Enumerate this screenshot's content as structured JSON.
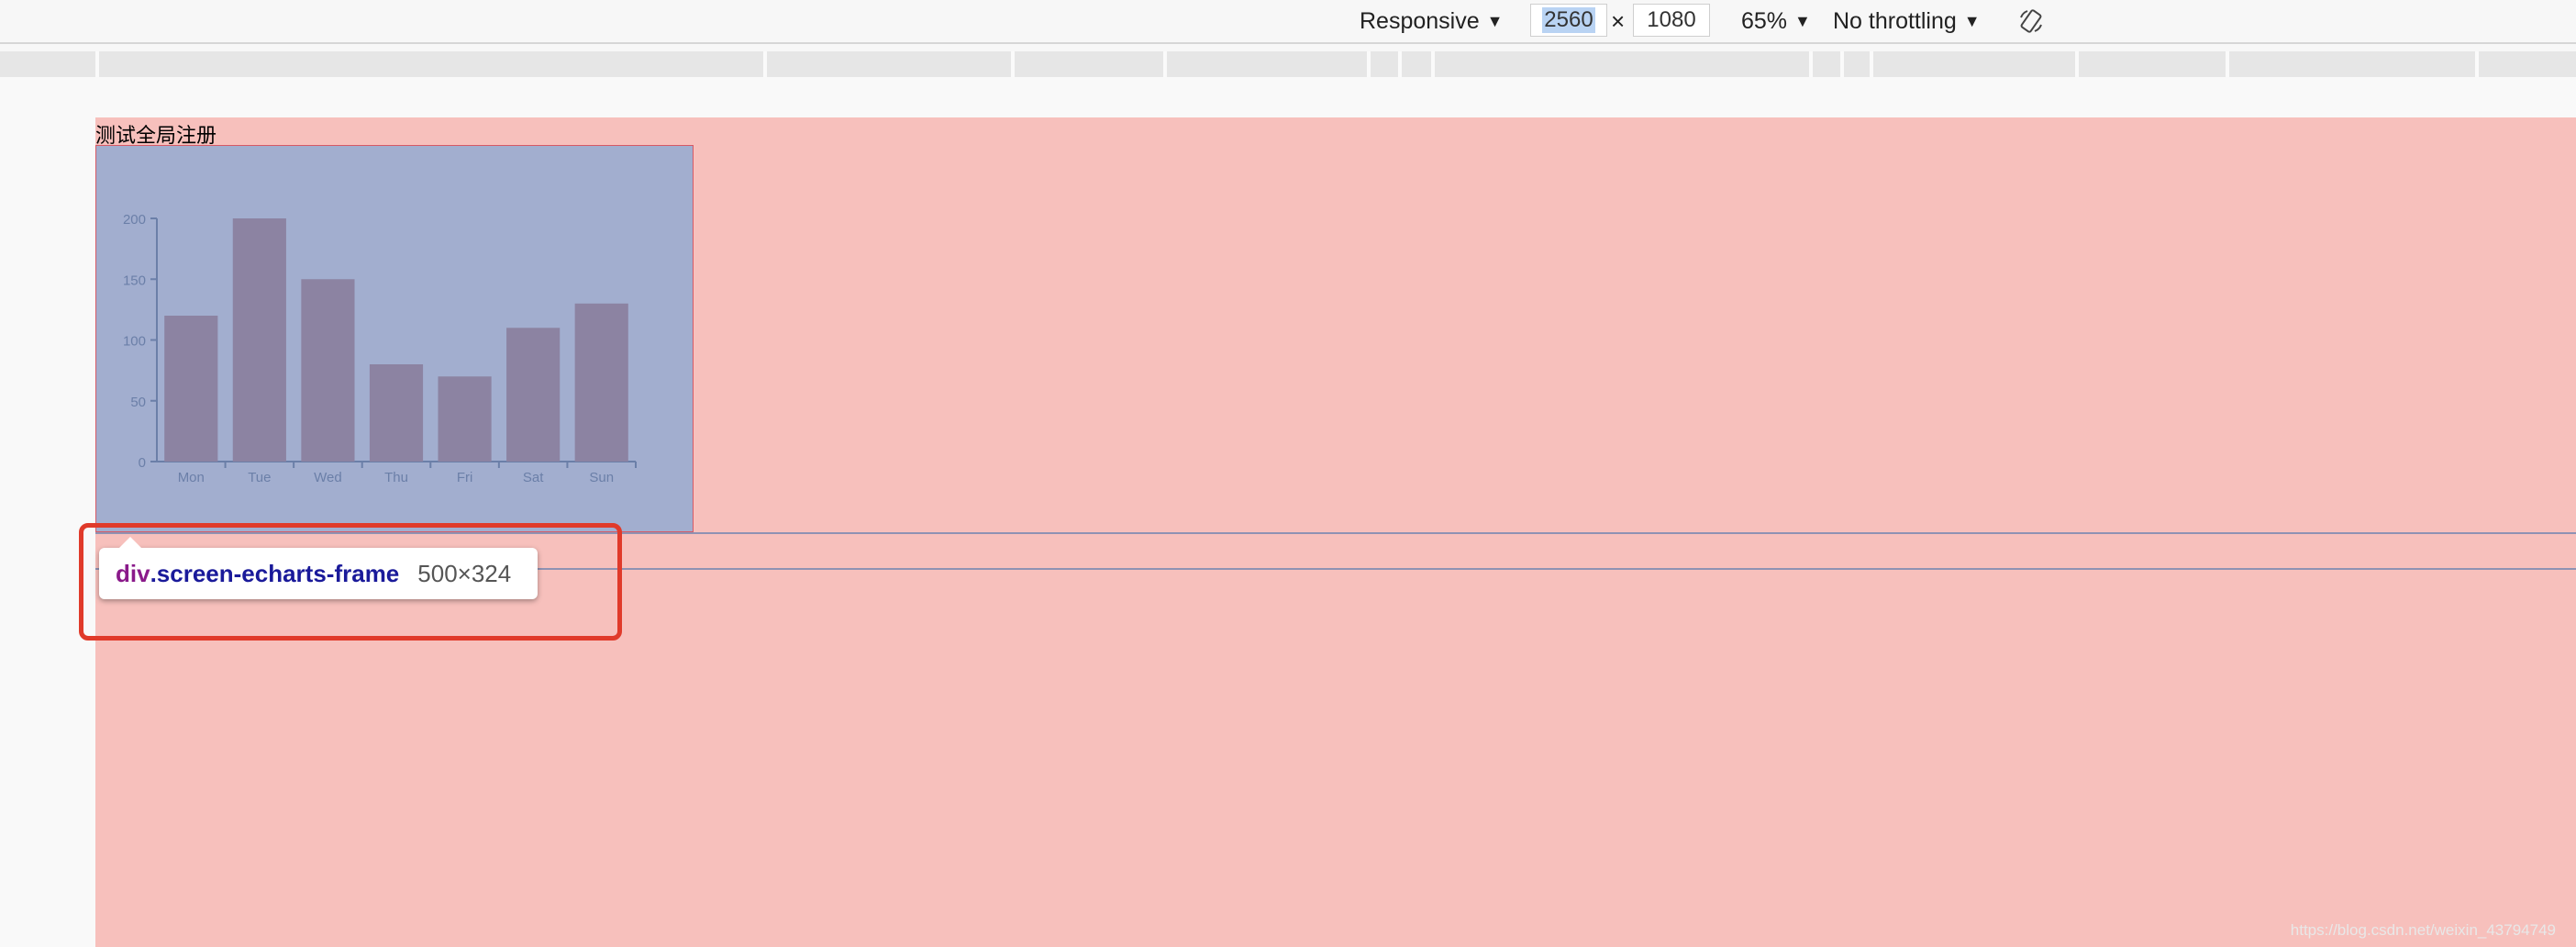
{
  "toolbar": {
    "device": "Responsive",
    "width_value": "2560",
    "times": "×",
    "height_value": "1080",
    "zoom": "65%",
    "throttling": "No throttling",
    "rotate_icon": "rotate-icon",
    "caret_icon": "caret-down-icon"
  },
  "page": {
    "title": "测试全局注册"
  },
  "inspector": {
    "tag": "div",
    "class_name": ".screen-echarts-frame",
    "size": "500×324"
  },
  "watermark": "https://blog.csdn.net/weixin_43794749",
  "colors": {
    "page_bg": "#f7c0bc",
    "highlight": "#a2aecf",
    "bar": "#8c83a2",
    "axis": "#6b7fa8",
    "callout": "#e03a2a"
  },
  "chart_data": {
    "type": "bar",
    "categories": [
      "Mon",
      "Tue",
      "Wed",
      "Thu",
      "Fri",
      "Sat",
      "Sun"
    ],
    "values": [
      120,
      200,
      150,
      80,
      70,
      110,
      130
    ],
    "yticks": [
      "0",
      "50",
      "100",
      "150",
      "200"
    ],
    "ylim": [
      0,
      200
    ],
    "title": "",
    "xlabel": "",
    "ylabel": ""
  }
}
